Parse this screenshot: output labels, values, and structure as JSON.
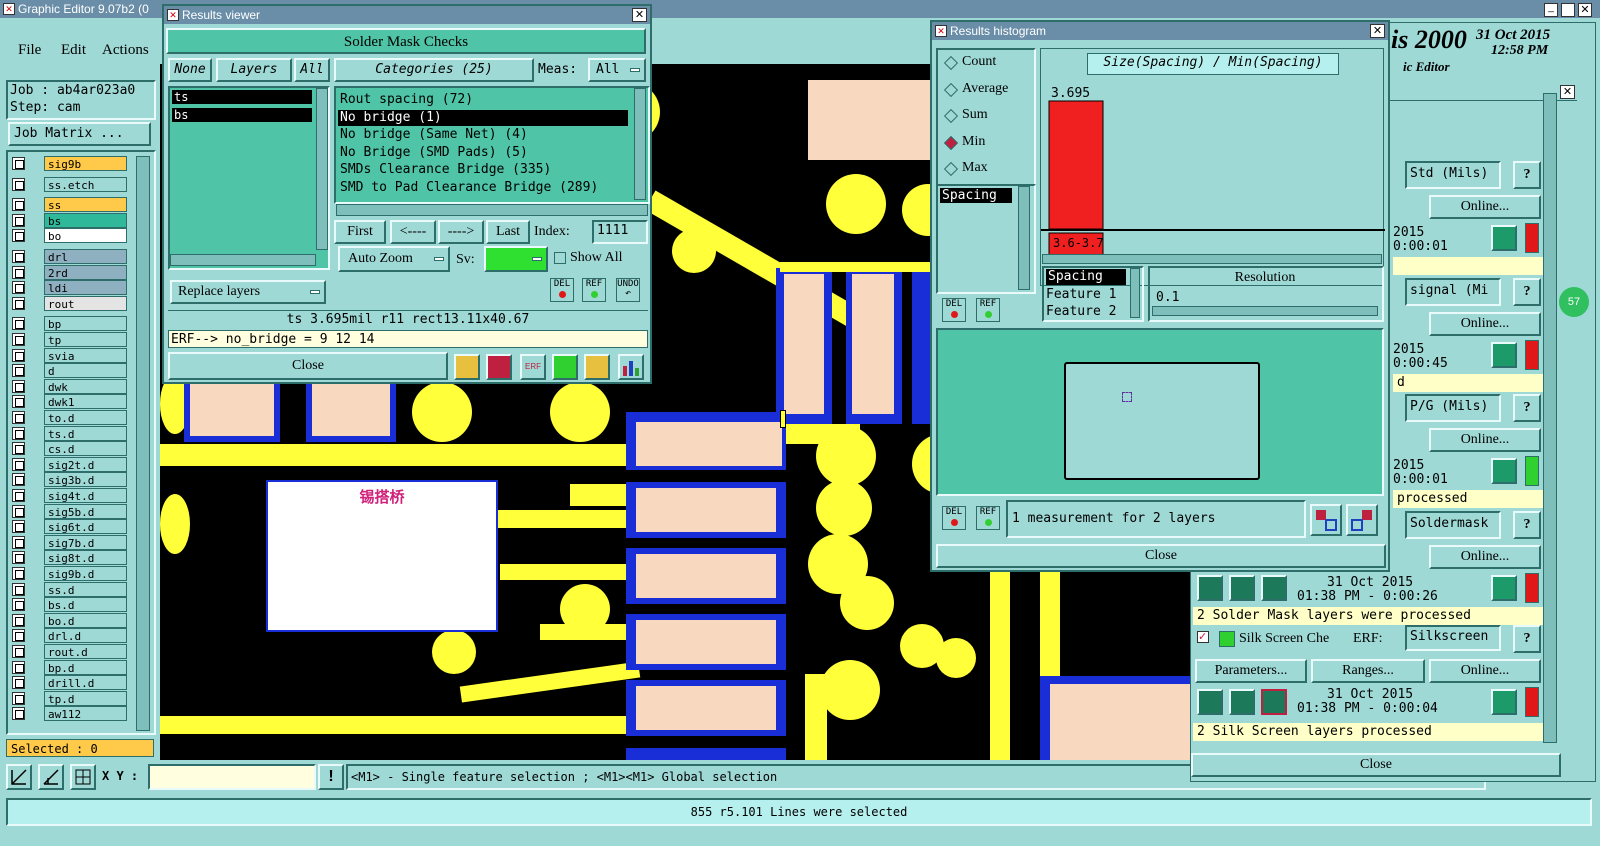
{
  "main": {
    "title": "Graphic Editor 9.07b2 (0",
    "menu": [
      "File",
      "Edit",
      "Actions"
    ],
    "job_label": "Job : ab4ar023a0",
    "step_label": "Step: cam",
    "job_matrix_btn": "Job Matrix ...",
    "selected": "Selected : 0",
    "xy_label": "X Y :",
    "xy_value": "",
    "hint": "<M1> - Single feature selection ; <M1><M1> Global selection",
    "status": "855 r5.101 Lines were selected",
    "canvas_label": "锡搭桥"
  },
  "layers": [
    "sig9b",
    "ss.etch",
    "ss",
    "bs",
    "bo",
    "drl",
    "2rd",
    "ldi",
    "rout",
    "bp",
    "tp",
    "svia",
    "d",
    "dwk",
    "dwk1",
    "to.d",
    "ts.d",
    "cs.d",
    "sig2t.d",
    "sig3b.d",
    "sig4t.d",
    "sig5b.d",
    "sig6t.d",
    "sig7b.d",
    "sig8t.d",
    "sig9b.d",
    "ss.d",
    "bs.d",
    "bo.d",
    "drl.d",
    "rout.d",
    "bp.d",
    "drill.d",
    "tp.d",
    "aw112"
  ],
  "layer_colors": {
    "sig9b": "#ffc94a",
    "ss": "#ffc94a",
    "bs": "#2fb99a",
    "bo": "#ffffff",
    "drl": "#8fb0c0",
    "2rd": "#8fb0c0",
    "ldi": "#8fb0c0",
    "rout": "#e4e4e4"
  },
  "results_viewer": {
    "title": "Results viewer",
    "heading": "Solder Mask Checks",
    "none_btn": "None",
    "layers_btn": "Layers",
    "all_btn": "All",
    "layers": [
      "ts",
      "bs"
    ],
    "categories_btn": "Categories (25)",
    "meas_label": "Meas:",
    "meas_value": "All",
    "categories": [
      "Rout spacing (72)",
      "No bridge (1)",
      "No bridge (Same Net) (4)",
      "No Bridge (SMD Pads) (5)",
      "SMDs Clearance Bridge (335)",
      "SMD to Pad Clearance Bridge (289)"
    ],
    "selected_category": 1,
    "first_btn": "First",
    "prev_btn": "<----",
    "next_btn": "---->",
    "last_btn": "Last",
    "index_label": "Index:",
    "index_value": "1111",
    "auto_zoom": "Auto Zoom",
    "sv_label": "Sv:",
    "show_all": "Show All",
    "replace_layers": "Replace layers",
    "info": "ts 3.695mil  r11  rect13.11x40.67",
    "erf": "ERF--> no_bridge = 9 12 14",
    "close": "Close",
    "del": "DEL",
    "ref": "REF",
    "undo": "UNDO"
  },
  "histogram": {
    "title": "Results histogram",
    "options": [
      "Count",
      "Average",
      "Sum",
      "Min",
      "Max"
    ],
    "selected": "Min",
    "chart_title": "Size(Spacing) / Min(Spacing)",
    "list": [
      "Spacing"
    ],
    "resolution_label": "Resolution",
    "resolution_value": "0.1",
    "features": [
      "Spacing",
      "Feature 1",
      "Feature 2"
    ],
    "summary": "1 measurement for 2 layers",
    "close": "Close",
    "del": "DEL",
    "ref": "REF"
  },
  "chart_data": {
    "type": "bar",
    "categories": [
      "3.6-3.7"
    ],
    "values": [
      3.695
    ],
    "title": "Size(Spacing) / Min(Spacing)",
    "data_labels": [
      "3.695"
    ]
  },
  "bg_window": {
    "title_fragment": "is 2000",
    "date": "31 Oct 2015",
    "time": "12:58 PM",
    "subtitle": "ic Editor"
  },
  "checks_panel": {
    "rows": [
      {
        "unit": "Std (Mils)",
        "online": "Online...",
        "date": "2015",
        "time": "0:00:01",
        "led": "#e01818",
        "status": ""
      },
      {
        "unit": "signal (Mi",
        "online": "Online...",
        "date": "2015",
        "time": "0:00:45",
        "led": "#e01818",
        "status": "d"
      },
      {
        "unit": "P/G (Mils)",
        "online": "Online...",
        "date": "2015",
        "time": "0:00:01",
        "led": "#30d030",
        "status": "processed"
      },
      {
        "unit": "Soldermask",
        "online": "Online...",
        "date": "31 Oct 2015",
        "time": "01:38 PM - 0:00:26",
        "led": "#e01818",
        "status": "2 Solder Mask layers were processed"
      }
    ],
    "silk_name": "Silk Screen Che",
    "erf_label": "ERF:",
    "silk_unit": "Silkscreen",
    "params_btn": "Parameters...",
    "ranges_btn": "Ranges...",
    "silk_online": "Online...",
    "silk_date": "31 Oct 2015",
    "silk_time": "01:38 PM - 0:00:04",
    "silk_status": "2 Silk Screen layers processed",
    "close": "Close",
    "badge": "57"
  }
}
